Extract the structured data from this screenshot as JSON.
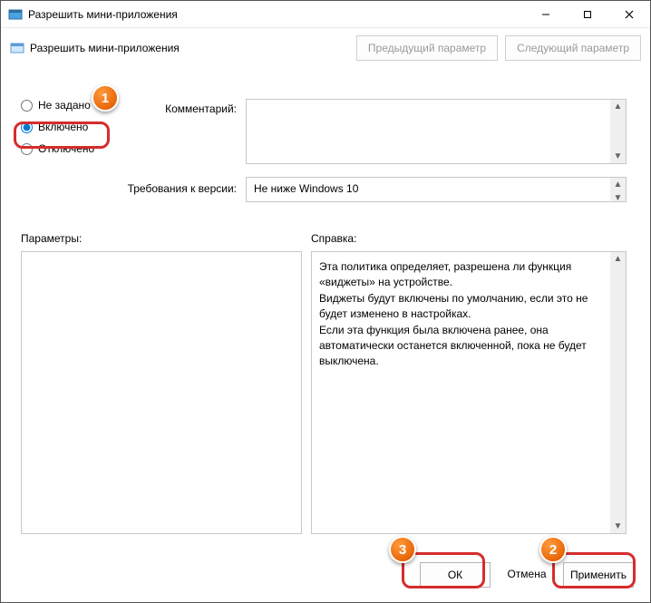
{
  "window": {
    "title": "Разрешить мини-приложения"
  },
  "header": {
    "title": "Разрешить мини-приложения",
    "prev": "Предыдущий параметр",
    "next": "Следующий параметр"
  },
  "radios": {
    "not_configured": "Не задано",
    "enabled": "Включено",
    "disabled": "Отключено"
  },
  "labels": {
    "comment": "Комментарий:",
    "requirements": "Требования к версии:",
    "parameters": "Параметры:",
    "help": "Справка:"
  },
  "fields": {
    "comment_value": "",
    "requirements_value": "Не ниже Windows 10"
  },
  "help_text": "Эта политика определяет, разрешена ли функция «виджеты» на устройстве.\nВиджеты будут включены по умолчанию, если это не будет изменено в настройках.\nЕсли эта функция была включена ранее, она автоматически останется включенной, пока не будет выключена.",
  "buttons": {
    "ok": "ОК",
    "cancel": "Отмена",
    "apply": "Применить"
  },
  "callouts": {
    "one": "1",
    "two": "2",
    "three": "3"
  }
}
